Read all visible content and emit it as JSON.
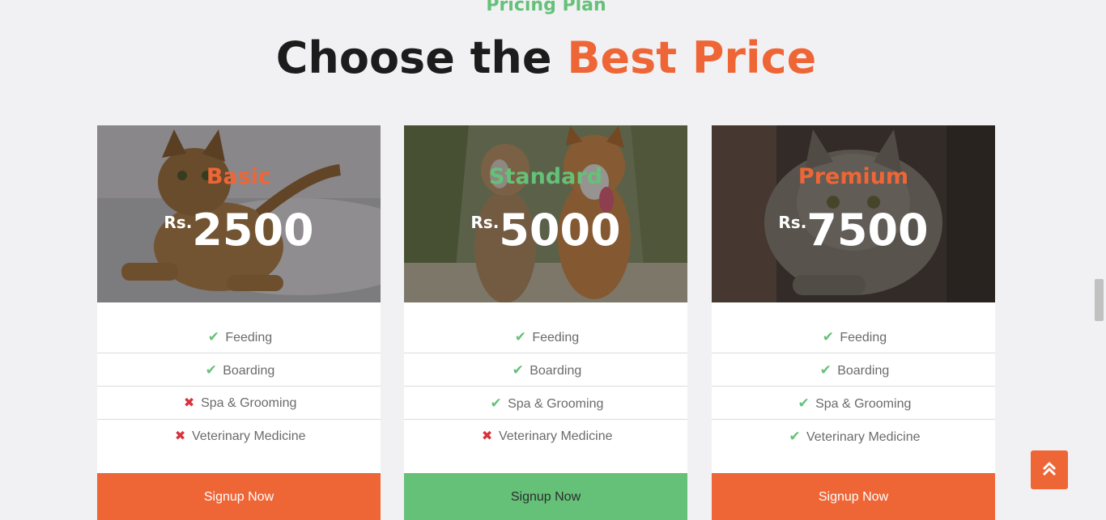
{
  "section": {
    "eyebrow": "Pricing Plan",
    "heading_plain": "Choose the ",
    "heading_accent": "Best Price"
  },
  "colors": {
    "orange": "#ef6636",
    "green": "#65c178",
    "red_x": "#d8323c"
  },
  "plans": [
    {
      "name": "Basic",
      "currency": "Rs.",
      "price": "2500",
      "name_color": "orange",
      "image": "tabby-cat-on-bed",
      "features": [
        {
          "label": "Feeding",
          "included": true
        },
        {
          "label": "Boarding",
          "included": true
        },
        {
          "label": "Spa & Grooming",
          "included": false
        },
        {
          "label": "Veterinary Medicine",
          "included": false
        }
      ],
      "button_label": "Signup Now",
      "button_color": "orange"
    },
    {
      "name": "Standard",
      "currency": "Rs.",
      "price": "5000",
      "name_color": "green",
      "image": "two-dogs-running",
      "features": [
        {
          "label": "Feeding",
          "included": true
        },
        {
          "label": "Boarding",
          "included": true
        },
        {
          "label": "Spa & Grooming",
          "included": true
        },
        {
          "label": "Veterinary Medicine",
          "included": false
        }
      ],
      "button_label": "Signup Now",
      "button_color": "green"
    },
    {
      "name": "Premium",
      "currency": "Rs.",
      "price": "7500",
      "name_color": "orange",
      "image": "grey-tabby-cat-closeup",
      "features": [
        {
          "label": "Feeding",
          "included": true
        },
        {
          "label": "Boarding",
          "included": true
        },
        {
          "label": "Spa & Grooming",
          "included": true
        },
        {
          "label": "Veterinary Medicine",
          "included": true
        }
      ],
      "button_label": "Signup Now",
      "button_color": "orange"
    }
  ],
  "back_to_top": {
    "icon": "double-chevron-up-icon"
  }
}
